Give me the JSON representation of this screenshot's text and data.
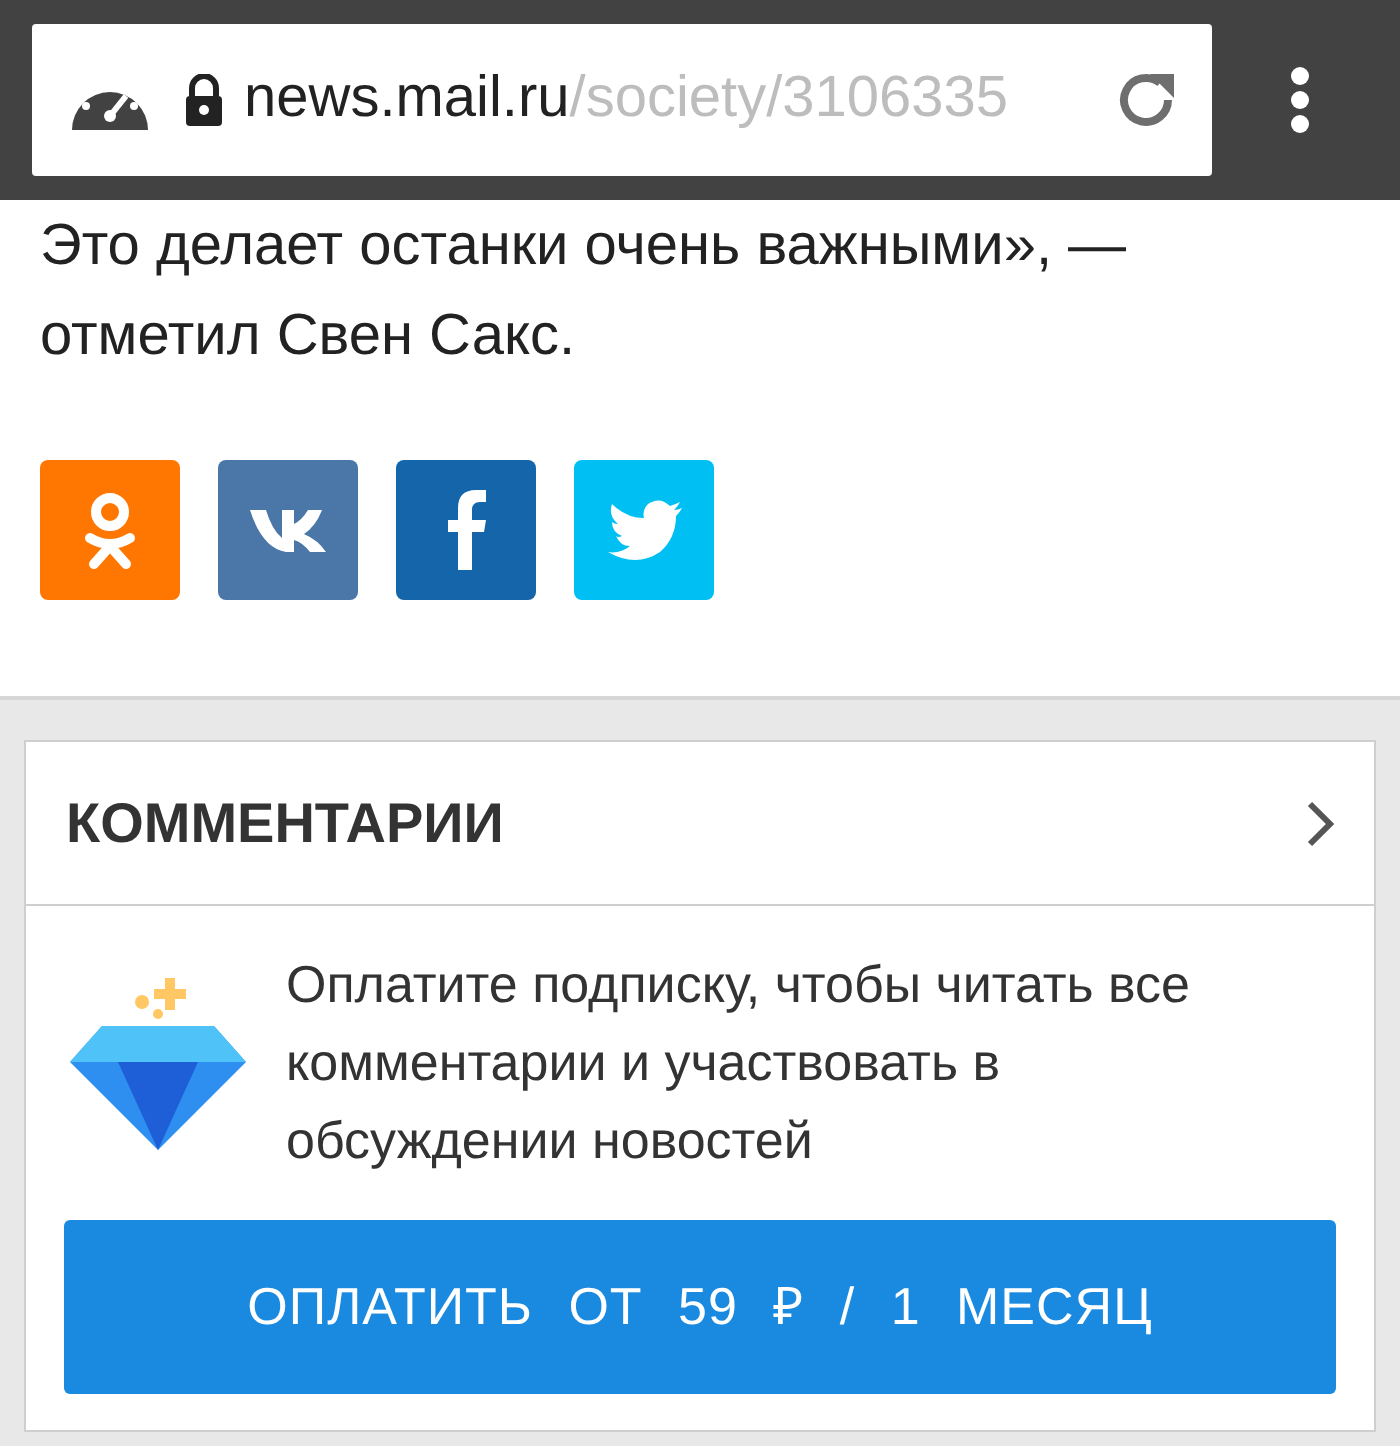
{
  "browser": {
    "domain": "news.mail.ru",
    "path": "/society/3106335"
  },
  "article": {
    "text": "Это делает останки очень важными», — отметил Свен Сакс."
  },
  "share_buttons": [
    {
      "kind": "ok",
      "color": "#ff7700"
    },
    {
      "kind": "vk",
      "color": "#4a76a8"
    },
    {
      "kind": "fb",
      "color": "#1565ab"
    },
    {
      "kind": "tw",
      "color": "#00bff3"
    }
  ],
  "comments": {
    "title": "КОММЕНТАРИИ",
    "promo": "Оплатите подписку, чтобы читать все комментарии и участвовать в обсуждении новостей",
    "button": "ОПЛАТИТЬ ОТ 59 ₽ / 1 МЕСЯЦ"
  }
}
